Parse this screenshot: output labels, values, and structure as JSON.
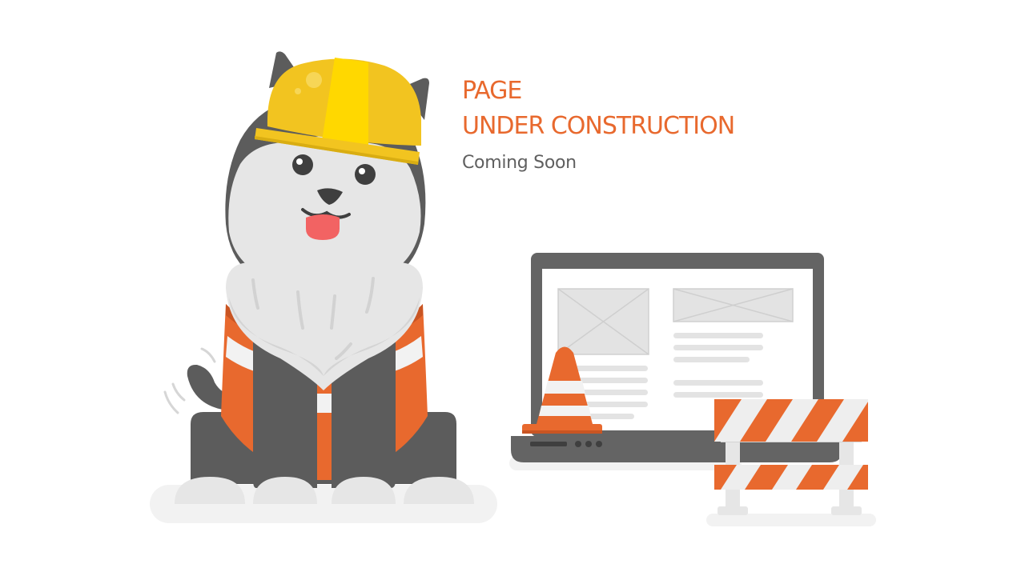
{
  "message": {
    "line1": "PAGE",
    "line2": "UNDER CONSTRUCTION",
    "subtitle": "Coming Soon"
  },
  "illustration": {
    "subjects": [
      "husky-dog-icon",
      "hard-hat-icon",
      "safety-vest-icon",
      "laptop-icon",
      "traffic-cone-icon",
      "road-barrier-icon"
    ]
  },
  "colors": {
    "accent_orange": "#e8692e",
    "subtitle_gray": "#5f5f5f",
    "helmet_yellow": "#f2c420",
    "fur_dark": "#5c5c5c",
    "fur_light": "#e8e8e8",
    "tongue": "#f26363",
    "ground": "#f2f2f2"
  }
}
